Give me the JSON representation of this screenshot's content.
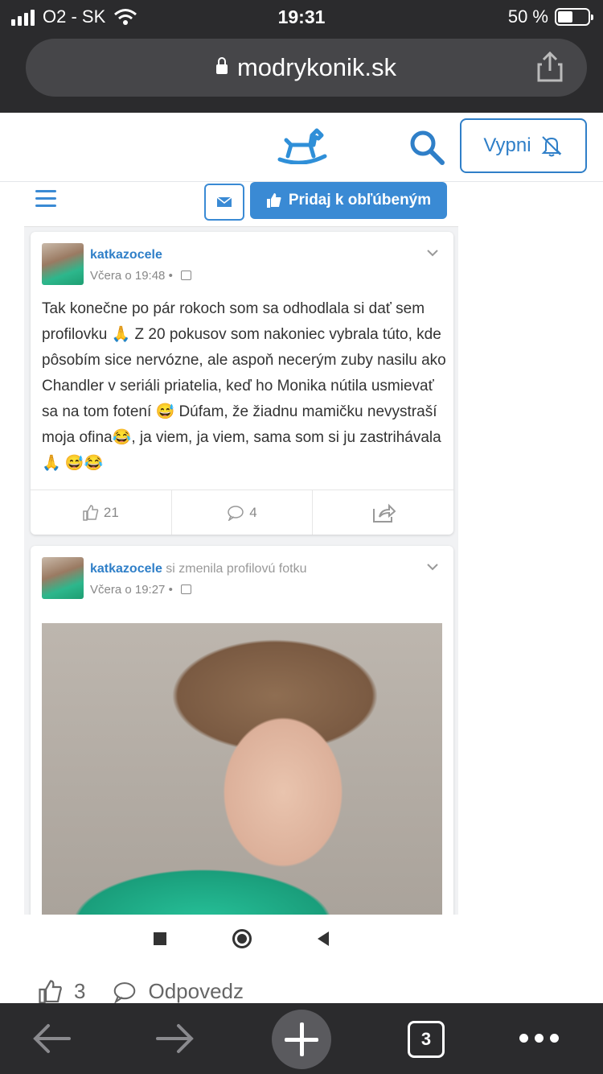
{
  "status": {
    "carrier": "O2 - SK",
    "time": "19:31",
    "battery": "50 %",
    "battery_level": 0.5
  },
  "browser": {
    "url": "modrykonik.sk"
  },
  "site": {
    "vypni_label": "Vypni"
  },
  "feed": {
    "favorite_label": "Pridaj k obľúbeným",
    "post1": {
      "username": "katkazocele",
      "time": "Včera o 19:48",
      "text": "Tak konečne po pár rokoch som sa odhodlala si dať sem profilovku 🙏 Z 20 pokusov som nakoniec vybrala túto, kde pôsobím sice nervózne, ale aspoň necerým zuby nasilu ako Chandler v seriáli priatelia, keď ho Monika nútila usmievať sa na tom fotení 😅 Dúfam, že žiadnu mamičku nevystraší moja ofina😂, ja viem, ja viem, sama som si ju zastrihávala 🙏 😅😂",
      "likes": "21",
      "comments": "4"
    },
    "post2": {
      "username": "katkazocele",
      "action": "si zmenila profilovú fotku",
      "time": "Včera o 19:27"
    }
  },
  "reply_row": {
    "likes": "3",
    "reply_label": "Odpovedz"
  },
  "bottom": {
    "tabs_count": "3"
  },
  "colors": {
    "accent": "#2f7fc8",
    "dark_bar": "#2b2b2d"
  }
}
